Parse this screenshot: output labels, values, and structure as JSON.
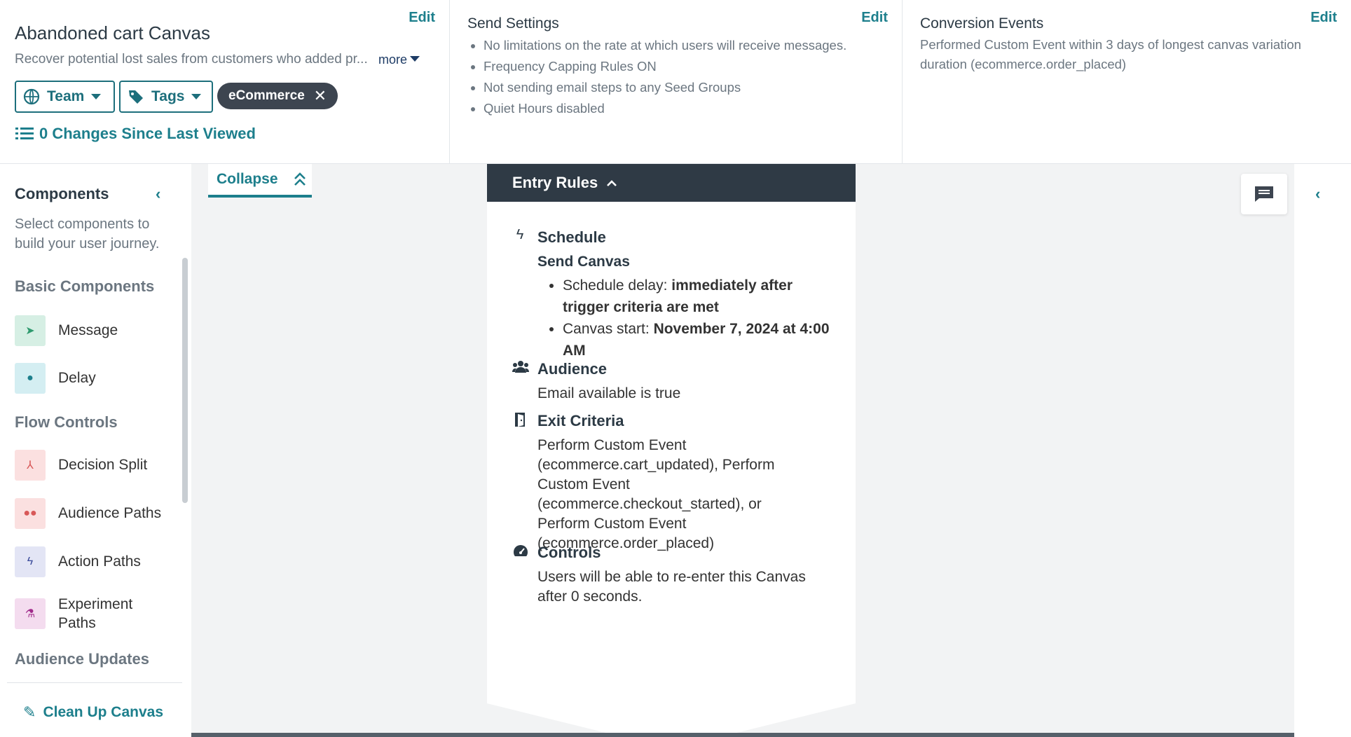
{
  "header": {
    "canvas_name": "Abandoned cart Canvas",
    "description": "Recover potential lost sales from customers who added pr...",
    "more_label": "more",
    "edit_label": "Edit",
    "team_label": "Team",
    "tags_label": "Tags",
    "tag_chip": "eCommerce",
    "changes_label": "0 Changes Since Last Viewed"
  },
  "send_settings": {
    "title": "Send Settings",
    "edit_label": "Edit",
    "items": [
      "No limitations on the rate at which users will receive messages.",
      "Frequency Capping Rules ON",
      "Not sending email steps to any Seed Groups",
      "Quiet Hours disabled"
    ]
  },
  "conversion": {
    "title": "Conversion Events",
    "edit_label": "Edit",
    "description": "Performed Custom Event within 3 days of longest canvas variation duration (ecommerce.order_placed)"
  },
  "sidebar": {
    "title": "Components",
    "description": "Select components to build your user journey.",
    "sections": {
      "basic": "Basic Components",
      "flow": "Flow Controls",
      "audience": "Audience Updates"
    },
    "items": {
      "message": "Message",
      "delay": "Delay",
      "decision_split": "Decision Split",
      "audience_paths": "Audience Paths",
      "action_paths": "Action Paths",
      "experiment_paths": "Experiment Paths"
    },
    "cleanup_label": "Clean Up Canvas"
  },
  "workspace": {
    "collapse_label": "Collapse",
    "entry_rules": {
      "title": "Entry Rules",
      "schedule_title": "Schedule",
      "send_canvas": "Send Canvas",
      "delay_label": "Schedule delay: ",
      "delay_value": "immediately after trigger criteria are met",
      "start_label": "Canvas start: ",
      "start_value": "November 7, 2024 at 4:00 AM",
      "audience_title": "Audience",
      "audience_text": "Email available is true",
      "exit_title": "Exit Criteria",
      "exit_text": "Perform Custom Event (ecommerce.cart_updated), Perform Custom Event (ecommerce.checkout_started), or Perform Custom Event (ecommerce.order_placed)",
      "controls_title": "Controls",
      "controls_text": "Users will be able to re-enter this Canvas after 0 seconds."
    }
  },
  "colors": {
    "accent": "#1d7f8c",
    "entry_header": "#2f3a45",
    "workspace_bg": "#f2f3f4"
  }
}
